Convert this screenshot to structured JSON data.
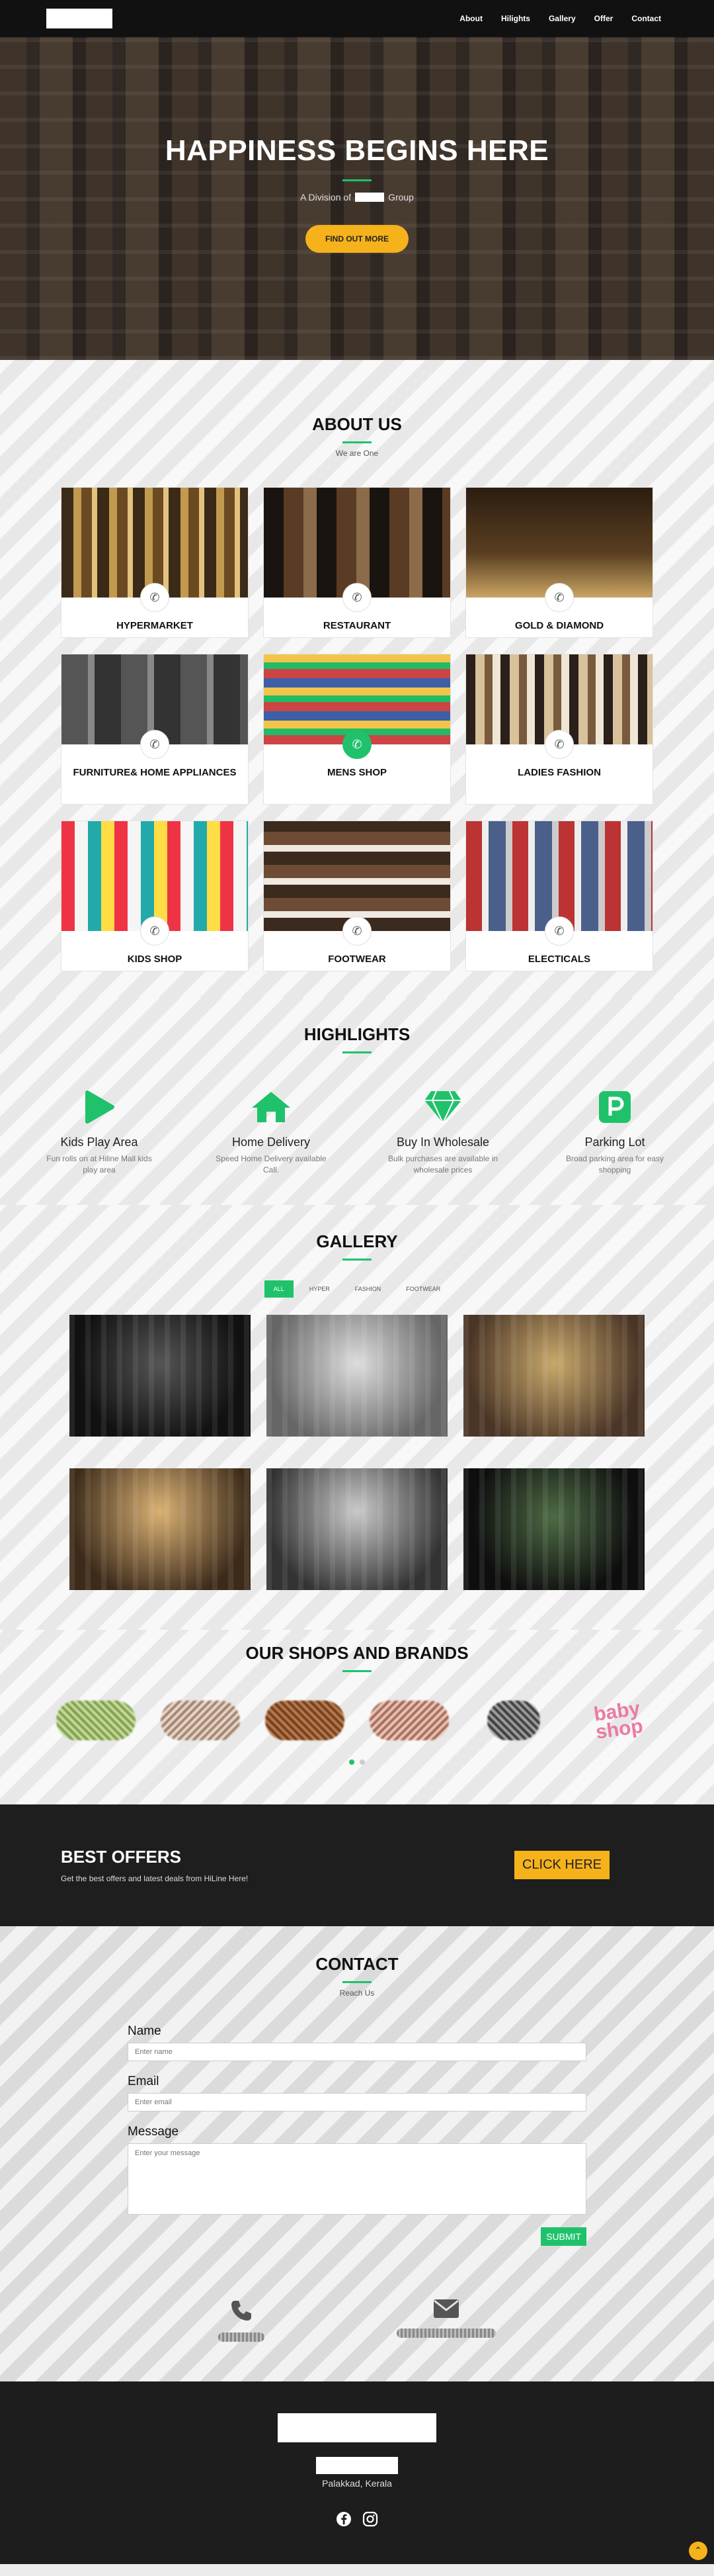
{
  "nav": {
    "links": [
      "About",
      "Hilights",
      "Gallery",
      "Offer",
      "Contact"
    ]
  },
  "hero": {
    "title": "HAPPINESS BEGINS HERE",
    "subtitle_pre": "A Division of",
    "subtitle_post": "Group",
    "button": "FIND OUT MORE"
  },
  "about": {
    "title": "ABOUT US",
    "subtitle": "We are One",
    "cards": [
      {
        "label": "HYPERMARKET"
      },
      {
        "label": "RESTAURANT"
      },
      {
        "label": "GOLD & DIAMOND"
      },
      {
        "label": "FURNITURE& HOME APPLIANCES"
      },
      {
        "label": "MENS SHOP"
      },
      {
        "label": "LADIES FASHION"
      },
      {
        "label": "KIDS SHOP"
      },
      {
        "label": "FOOTWEAR"
      },
      {
        "label": "ELECTICALS"
      }
    ]
  },
  "highlights": {
    "title": "HIGHLIGHTS",
    "items": [
      {
        "title": "Kids Play Area",
        "desc": "Fun rolls on at Hiline Mall kids play area",
        "icon": "play-icon"
      },
      {
        "title": "Home Delivery",
        "desc": "Speed Home Delivery available Call.",
        "icon": "home-icon"
      },
      {
        "title": "Buy In Wholesale",
        "desc": "Bulk purchases are available in wholesale prices",
        "icon": "diamond-icon"
      },
      {
        "title": "Parking Lot",
        "desc": "Broad parking area for easy shopping",
        "icon": "parking-icon"
      }
    ]
  },
  "gallery": {
    "title": "GALLERY",
    "filters": [
      "ALL",
      "HYPER",
      "FASHION",
      "FOOTWEAR"
    ]
  },
  "brands": {
    "title": "OUR SHOPS AND BRANDS",
    "baby_shop": "baby shop"
  },
  "offers": {
    "title": "BEST OFFERS",
    "desc": "Get the best offers and latest deals from HiLine Here!",
    "button": "CLICK HERE"
  },
  "contact": {
    "title": "CONTACT",
    "subtitle": "Reach Us",
    "name_label": "Name",
    "name_placeholder": "Enter name",
    "email_label": "Email",
    "email_placeholder": "Enter email",
    "message_label": "Message",
    "message_placeholder": "Enter your message",
    "submit": "SUBMIT"
  },
  "footer": {
    "city": "Palakkad, Kerala"
  },
  "colors": {
    "accent": "#1fc26b",
    "cta": "#f5b21b"
  }
}
